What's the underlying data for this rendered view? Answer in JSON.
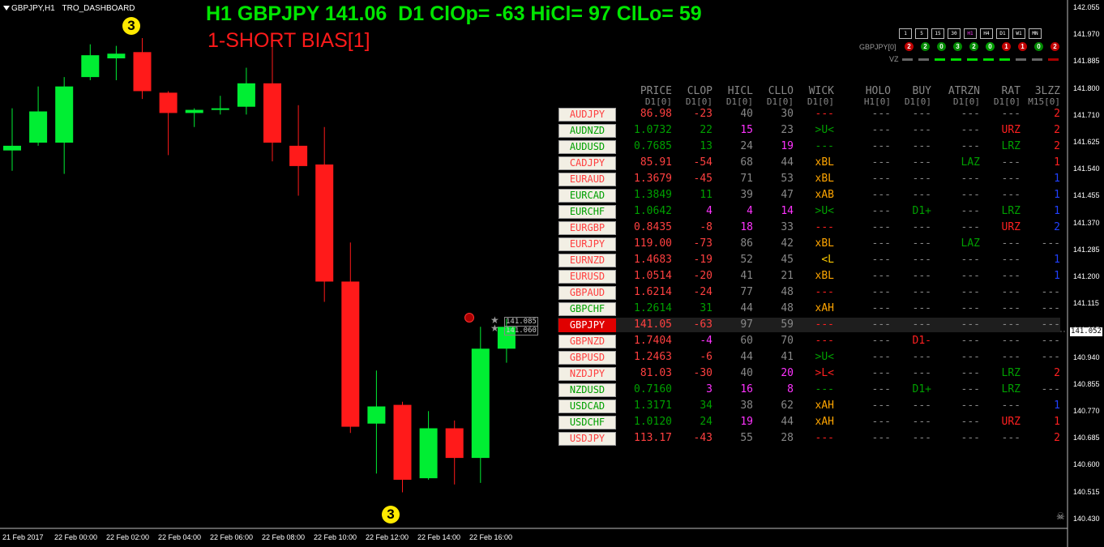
{
  "window": {
    "title": "GBPJPY,H1"
  },
  "chart_label": "TRO_DASHBOARD",
  "header": {
    "line1": "H1 GBPJPY 141.06  D1 ClOp= -63 HiCl= 97 ClLo= 59",
    "line2": "1-SHORT BIAS[1]"
  },
  "timeframes": [
    {
      "label": "1",
      "hl": false
    },
    {
      "label": "5",
      "hl": false
    },
    {
      "label": "15",
      "hl": false
    },
    {
      "label": "30",
      "hl": false
    },
    {
      "label": "H1",
      "hl": true
    },
    {
      "label": "H4",
      "hl": false
    },
    {
      "label": "D1",
      "hl": false
    },
    {
      "label": "W1",
      "hl": false
    },
    {
      "label": "MN",
      "hl": false
    }
  ],
  "signals": {
    "label": "GBPJPY[0]",
    "items": [
      {
        "n": "2",
        "color": "#c00000"
      },
      {
        "n": "2",
        "color": "#008a00"
      },
      {
        "n": "0",
        "color": "#008a00"
      },
      {
        "n": "3",
        "color": "#008a00"
      },
      {
        "n": "2",
        "color": "#008a00"
      },
      {
        "n": "0",
        "color": "#00a000"
      },
      {
        "n": "1",
        "color": "#c00000"
      },
      {
        "n": "1",
        "color": "#c00000"
      },
      {
        "n": "0",
        "color": "#008a00"
      },
      {
        "n": "2",
        "color": "#c00000"
      }
    ]
  },
  "vz": {
    "label": "VZ",
    "bars": [
      "#666666",
      "#666666",
      "#00dd00",
      "#00dd00",
      "#00dd00",
      "#00dd00",
      "#00dd00",
      "#666666",
      "#666666",
      "#aa0000"
    ]
  },
  "columns": [
    {
      "name": "PRICE",
      "sub": "D1[0]",
      "right": 141
    },
    {
      "name": "CLOP",
      "sub": "D1[0]",
      "right": 191
    },
    {
      "name": "HICL",
      "sub": "D1[0]",
      "right": 241
    },
    {
      "name": "CLLO",
      "sub": "D1[0]",
      "right": 291
    },
    {
      "name": "WICK",
      "sub": "D1[0]",
      "right": 341
    },
    {
      "name": "HOLO",
      "sub": "H1[0]",
      "right": 411
    },
    {
      "name": "BUY",
      "sub": "D1[0]",
      "right": 461
    },
    {
      "name": "ATRZN",
      "sub": "D1[0]",
      "right": 521
    },
    {
      "name": "RAT",
      "sub": "D1[0]",
      "right": 571
    },
    {
      "name": "3LZZ",
      "sub": "M15[0]",
      "right": 620
    }
  ],
  "rows": [
    {
      "pair": "AUDJPY",
      "pc": "#ff4040",
      "price": "86.98",
      "clop": "-23",
      "clopc": "#ff4040",
      "hicl": "40",
      "hiclc": "#888888",
      "cllo": "30",
      "clloc": "#888888",
      "wick": "---",
      "wickc": "#ff2020",
      "holo": "---",
      "buy": "---",
      "buyc": "#888888",
      "atrzn": "---",
      "atrznc": "#888888",
      "rat": "---",
      "ratc": "#888888",
      "lzz": "2",
      "lzzc": "#ff2020"
    },
    {
      "pair": "AUDNZD",
      "pc": "#00a000",
      "price": "1.0732",
      "clop": "22",
      "clopc": "#00a000",
      "hicl": "15",
      "hiclc": "#ff33ff",
      "cllo": "23",
      "clloc": "#888888",
      "wick": ">U<",
      "wickc": "#00a000",
      "holo": "---",
      "buy": "---",
      "buyc": "#888888",
      "atrzn": "---",
      "atrznc": "#888888",
      "rat": "URZ",
      "ratc": "#ff2020",
      "lzz": "2",
      "lzzc": "#ff2020"
    },
    {
      "pair": "AUDUSD",
      "pc": "#00a000",
      "price": "0.7685",
      "clop": "13",
      "clopc": "#00a000",
      "hicl": "24",
      "hiclc": "#888888",
      "cllo": "19",
      "clloc": "#ff33ff",
      "wick": "---",
      "wickc": "#00a000",
      "holo": "---",
      "buy": "---",
      "buyc": "#888888",
      "atrzn": "---",
      "atrznc": "#888888",
      "rat": "LRZ",
      "ratc": "#00a000",
      "lzz": "2",
      "lzzc": "#ff2020"
    },
    {
      "pair": "CADJPY",
      "pc": "#ff4040",
      "price": "85.91",
      "clop": "-54",
      "clopc": "#ff4040",
      "hicl": "68",
      "hiclc": "#888888",
      "cllo": "44",
      "clloc": "#888888",
      "wick": "xBL",
      "wickc": "#ffa500",
      "holo": "---",
      "buy": "---",
      "buyc": "#888888",
      "atrzn": "LAZ",
      "atrznc": "#00a000",
      "rat": "---",
      "ratc": "#888888",
      "lzz": "1",
      "lzzc": "#ff2020"
    },
    {
      "pair": "EURAUD",
      "pc": "#ff4040",
      "price": "1.3679",
      "clop": "-45",
      "clopc": "#ff4040",
      "hicl": "71",
      "hiclc": "#888888",
      "cllo": "53",
      "clloc": "#888888",
      "wick": "xBL",
      "wickc": "#ffa500",
      "holo": "---",
      "buy": "---",
      "buyc": "#888888",
      "atrzn": "---",
      "atrznc": "#888888",
      "rat": "---",
      "ratc": "#888888",
      "lzz": "1",
      "lzzc": "#2040ff"
    },
    {
      "pair": "EURCAD",
      "pc": "#00a000",
      "price": "1.3849",
      "clop": "11",
      "clopc": "#00a000",
      "hicl": "39",
      "hiclc": "#888888",
      "cllo": "47",
      "clloc": "#888888",
      "wick": "xAB",
      "wickc": "#ffa500",
      "holo": "---",
      "buy": "---",
      "buyc": "#888888",
      "atrzn": "---",
      "atrznc": "#888888",
      "rat": "---",
      "ratc": "#888888",
      "lzz": "1",
      "lzzc": "#2040ff"
    },
    {
      "pair": "EURCHF",
      "pc": "#00a000",
      "price": "1.0642",
      "clop": "4",
      "clopc": "#ff33ff",
      "hicl": "4",
      "hiclc": "#ff33ff",
      "cllo": "14",
      "clloc": "#ff33ff",
      "wick": ">U<",
      "wickc": "#00a000",
      "holo": "---",
      "buy": "D1+",
      "buyc": "#00a000",
      "atrzn": "---",
      "atrznc": "#888888",
      "rat": "LRZ",
      "ratc": "#00a000",
      "lzz": "1",
      "lzzc": "#2040ff"
    },
    {
      "pair": "EURGBP",
      "pc": "#ff4040",
      "price": "0.8435",
      "clop": "-8",
      "clopc": "#ff4040",
      "hicl": "18",
      "hiclc": "#ff33ff",
      "cllo": "33",
      "clloc": "#888888",
      "wick": "---",
      "wickc": "#ff2020",
      "holo": "---",
      "buy": "---",
      "buyc": "#888888",
      "atrzn": "---",
      "atrznc": "#888888",
      "rat": "URZ",
      "ratc": "#ff2020",
      "lzz": "2",
      "lzzc": "#2040ff"
    },
    {
      "pair": "EURJPY",
      "pc": "#ff4040",
      "price": "119.00",
      "clop": "-73",
      "clopc": "#ff4040",
      "hicl": "86",
      "hiclc": "#888888",
      "cllo": "42",
      "clloc": "#888888",
      "wick": "xBL",
      "wickc": "#ffa500",
      "holo": "---",
      "buy": "---",
      "buyc": "#888888",
      "atrzn": "LAZ",
      "atrznc": "#00a000",
      "rat": "---",
      "ratc": "#888888",
      "lzz": "---",
      "lzzc": "#888888"
    },
    {
      "pair": "EURNZD",
      "pc": "#ff4040",
      "price": "1.4683",
      "clop": "-19",
      "clopc": "#ff4040",
      "hicl": "52",
      "hiclc": "#888888",
      "cllo": "45",
      "clloc": "#888888",
      "wick": "<L",
      "wickc": "#ffcc00",
      "holo": "---",
      "buy": "---",
      "buyc": "#888888",
      "atrzn": "---",
      "atrznc": "#888888",
      "rat": "---",
      "ratc": "#888888",
      "lzz": "1",
      "lzzc": "#2040ff"
    },
    {
      "pair": "EURUSD",
      "pc": "#ff4040",
      "price": "1.0514",
      "clop": "-20",
      "clopc": "#ff4040",
      "hicl": "41",
      "hiclc": "#888888",
      "cllo": "21",
      "clloc": "#888888",
      "wick": "xBL",
      "wickc": "#ffa500",
      "holo": "---",
      "buy": "---",
      "buyc": "#888888",
      "atrzn": "---",
      "atrznc": "#888888",
      "rat": "---",
      "ratc": "#888888",
      "lzz": "1",
      "lzzc": "#2040ff"
    },
    {
      "pair": "GBPAUD",
      "pc": "#ff4040",
      "price": "1.6214",
      "clop": "-24",
      "clopc": "#ff4040",
      "hicl": "77",
      "hiclc": "#888888",
      "cllo": "48",
      "clloc": "#888888",
      "wick": "---",
      "wickc": "#ff2020",
      "holo": "---",
      "buy": "---",
      "buyc": "#888888",
      "atrzn": "---",
      "atrznc": "#888888",
      "rat": "---",
      "ratc": "#888888",
      "lzz": "---",
      "lzzc": "#888888"
    },
    {
      "pair": "GBPCHF",
      "pc": "#00a000",
      "price": "1.2614",
      "clop": "31",
      "clopc": "#00a000",
      "hicl": "44",
      "hiclc": "#888888",
      "cllo": "48",
      "clloc": "#888888",
      "wick": "xAH",
      "wickc": "#ffa500",
      "holo": "---",
      "buy": "---",
      "buyc": "#888888",
      "atrzn": "---",
      "atrznc": "#888888",
      "rat": "---",
      "ratc": "#888888",
      "lzz": "---",
      "lzzc": "#888888"
    },
    {
      "pair": "GBPJPY",
      "pc": "#ff4040",
      "price": "141.05",
      "clop": "-63",
      "clopc": "#ff4040",
      "hicl": "97",
      "hiclc": "#888888",
      "cllo": "59",
      "clloc": "#888888",
      "wick": "---",
      "wickc": "#ff2020",
      "holo": "---",
      "buy": "---",
      "buyc": "#888888",
      "atrzn": "---",
      "atrznc": "#888888",
      "rat": "---",
      "ratc": "#888888",
      "lzz": "---",
      "lzzc": "#888888",
      "selected": true
    },
    {
      "pair": "GBPNZD",
      "pc": "#ff4040",
      "price": "1.7404",
      "clop": "-4",
      "clopc": "#ff33ff",
      "hicl": "60",
      "hiclc": "#888888",
      "cllo": "70",
      "clloc": "#888888",
      "wick": "---",
      "wickc": "#ff2020",
      "holo": "---",
      "buy": "D1-",
      "buyc": "#ff2020",
      "atrzn": "---",
      "atrznc": "#888888",
      "rat": "---",
      "ratc": "#888888",
      "lzz": "---",
      "lzzc": "#888888"
    },
    {
      "pair": "GBPUSD",
      "pc": "#ff4040",
      "price": "1.2463",
      "clop": "-6",
      "clopc": "#ff4040",
      "hicl": "44",
      "hiclc": "#888888",
      "cllo": "41",
      "clloc": "#888888",
      "wick": ">U<",
      "wickc": "#00a000",
      "holo": "---",
      "buy": "---",
      "buyc": "#888888",
      "atrzn": "---",
      "atrznc": "#888888",
      "rat": "---",
      "ratc": "#888888",
      "lzz": "---",
      "lzzc": "#888888"
    },
    {
      "pair": "NZDJPY",
      "pc": "#ff4040",
      "price": "81.03",
      "clop": "-30",
      "clopc": "#ff4040",
      "hicl": "40",
      "hiclc": "#888888",
      "cllo": "20",
      "clloc": "#ff33ff",
      "wick": ">L<",
      "wickc": "#ff2020",
      "holo": "---",
      "buy": "---",
      "buyc": "#888888",
      "atrzn": "---",
      "atrznc": "#888888",
      "rat": "LRZ",
      "ratc": "#00a000",
      "lzz": "2",
      "lzzc": "#ff2020"
    },
    {
      "pair": "NZDUSD",
      "pc": "#00a000",
      "price": "0.7160",
      "clop": "3",
      "clopc": "#ff33ff",
      "hicl": "16",
      "hiclc": "#ff33ff",
      "cllo": "8",
      "clloc": "#ff33ff",
      "wick": "---",
      "wickc": "#00a000",
      "holo": "---",
      "buy": "D1+",
      "buyc": "#00a000",
      "atrzn": "---",
      "atrznc": "#888888",
      "rat": "LRZ",
      "ratc": "#00a000",
      "lzz": "---",
      "lzzc": "#888888"
    },
    {
      "pair": "USDCAD",
      "pc": "#00a000",
      "price": "1.3171",
      "clop": "34",
      "clopc": "#00a000",
      "hicl": "38",
      "hiclc": "#888888",
      "cllo": "62",
      "clloc": "#888888",
      "wick": "xAH",
      "wickc": "#ffa500",
      "holo": "---",
      "buy": "---",
      "buyc": "#888888",
      "atrzn": "---",
      "atrznc": "#888888",
      "rat": "---",
      "ratc": "#888888",
      "lzz": "1",
      "lzzc": "#2040ff"
    },
    {
      "pair": "USDCHF",
      "pc": "#00a000",
      "price": "1.0120",
      "clop": "24",
      "clopc": "#00a000",
      "hicl": "19",
      "hiclc": "#ff33ff",
      "cllo": "44",
      "clloc": "#888888",
      "wick": "xAH",
      "wickc": "#ffa500",
      "holo": "---",
      "buy": "---",
      "buyc": "#888888",
      "atrzn": "---",
      "atrznc": "#888888",
      "rat": "URZ",
      "ratc": "#ff2020",
      "lzz": "1",
      "lzzc": "#ff2020"
    },
    {
      "pair": "USDJPY",
      "pc": "#ff4040",
      "price": "113.17",
      "clop": "-43",
      "clopc": "#ff4040",
      "hicl": "55",
      "hiclc": "#888888",
      "cllo": "28",
      "clloc": "#888888",
      "wick": "---",
      "wickc": "#ff2020",
      "holo": "---",
      "buy": "---",
      "buyc": "#888888",
      "atrzn": "---",
      "atrznc": "#888888",
      "rat": "---",
      "ratc": "#888888",
      "lzz": "2",
      "lzzc": "#ff2020"
    }
  ],
  "price_marker": "141.052",
  "price_tags": [
    "141.085",
    "141.060"
  ],
  "markers": [
    "3",
    "3"
  ],
  "chart_data": {
    "type": "candlestick",
    "symbol": "GBPJPY",
    "timeframe": "H1",
    "ylim": [
      140.43,
      142.055
    ],
    "yticks": [
      "142.055",
      "141.970",
      "141.885",
      "141.800",
      "141.710",
      "141.625",
      "141.540",
      "141.455",
      "141.370",
      "141.285",
      "141.200",
      "141.115",
      "141.025",
      "140.940",
      "140.855",
      "140.770",
      "140.685",
      "140.600",
      "140.515",
      "140.430"
    ],
    "xticks": [
      "21 Feb 2017",
      "22 Feb 00:00",
      "22 Feb 02:00",
      "22 Feb 04:00",
      "22 Feb 06:00",
      "22 Feb 08:00",
      "22 Feb 10:00",
      "22 Feb 12:00",
      "22 Feb 14:00",
      "22 Feb 16:00"
    ],
    "candles": [
      {
        "o": 141.625,
        "h": 141.76,
        "l": 141.56,
        "c": 141.64
      },
      {
        "o": 141.65,
        "h": 141.83,
        "l": 141.64,
        "c": 141.75
      },
      {
        "o": 141.65,
        "h": 141.86,
        "l": 141.55,
        "c": 141.83
      },
      {
        "o": 141.86,
        "h": 141.965,
        "l": 141.85,
        "c": 141.93
      },
      {
        "o": 141.92,
        "h": 141.96,
        "l": 141.85,
        "c": 141.935
      },
      {
        "o": 141.94,
        "h": 141.985,
        "l": 141.79,
        "c": 141.815
      },
      {
        "o": 141.81,
        "h": 141.815,
        "l": 141.61,
        "c": 141.745
      },
      {
        "o": 141.745,
        "h": 141.76,
        "l": 141.7,
        "c": 141.755
      },
      {
        "o": 141.755,
        "h": 141.8,
        "l": 141.74,
        "c": 141.76
      },
      {
        "o": 141.765,
        "h": 141.89,
        "l": 141.74,
        "c": 141.84
      },
      {
        "o": 141.84,
        "h": 141.98,
        "l": 141.59,
        "c": 141.65
      },
      {
        "o": 141.64,
        "h": 141.77,
        "l": 141.48,
        "c": 141.575
      },
      {
        "o": 141.58,
        "h": 141.7,
        "l": 141.14,
        "c": 141.205
      },
      {
        "o": 141.205,
        "h": 141.33,
        "l": 140.72,
        "c": 140.74
      },
      {
        "o": 140.75,
        "h": 140.92,
        "l": 140.59,
        "c": 140.805
      },
      {
        "o": 140.81,
        "h": 140.82,
        "l": 140.53,
        "c": 140.57
      },
      {
        "o": 140.575,
        "h": 140.79,
        "l": 140.57,
        "c": 140.735
      },
      {
        "o": 140.735,
        "h": 140.76,
        "l": 140.555,
        "c": 140.64
      },
      {
        "o": 140.64,
        "h": 141.06,
        "l": 140.56,
        "c": 140.99
      },
      {
        "o": 140.99,
        "h": 141.085,
        "l": 140.945,
        "c": 141.06
      }
    ]
  }
}
